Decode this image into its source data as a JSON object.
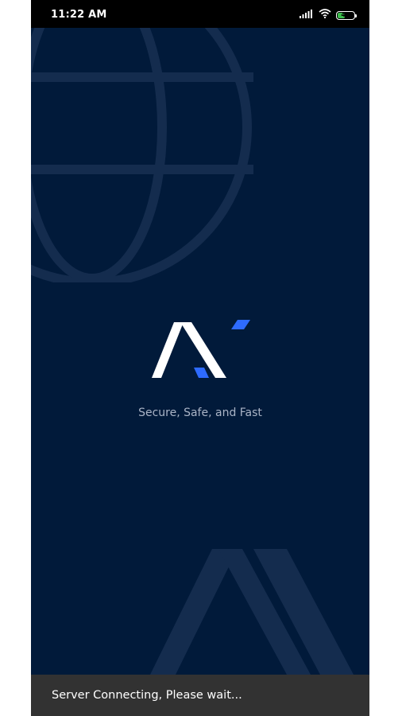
{
  "status_bar": {
    "time": "11:22 AM",
    "battery_level": "44",
    "battery_fill_percent": 44,
    "icons": [
      "signal-icon",
      "wifi-icon",
      "battery-icon"
    ]
  },
  "splash": {
    "tagline": "Secure, Safe, and Fast",
    "logo_icon": "app-logo-icon",
    "background_icons": [
      "globe-icon",
      "logo-watermark-icon"
    ]
  },
  "snackbar": {
    "message": "Server Connecting, Please wait..."
  },
  "colors": {
    "background": "#011a3a",
    "accent": "#2e6bff",
    "logo_white": "#ffffff",
    "watermark": "#142c4e"
  }
}
